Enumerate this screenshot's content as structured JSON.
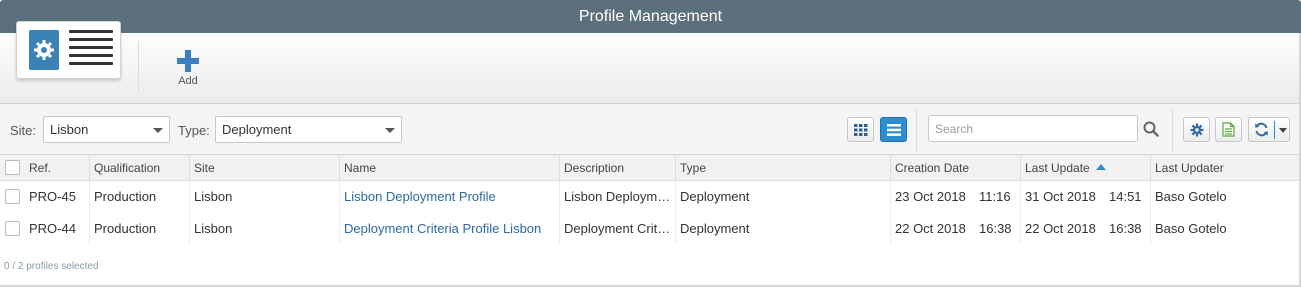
{
  "window": {
    "title": "Profile Management"
  },
  "toolbar": {
    "add_label": "Add"
  },
  "filters": {
    "site_label": "Site:",
    "site_value": "Lisbon",
    "type_label": "Type:",
    "type_value": "Deployment"
  },
  "search": {
    "placeholder": "Search"
  },
  "table": {
    "columns": [
      "Ref.",
      "Qualification",
      "Site",
      "Name",
      "Description",
      "Type",
      "Creation Date",
      "Last Update",
      "Last Updater"
    ],
    "sorted_column": "Last Update",
    "sort_direction": "ascending",
    "rows": [
      {
        "ref": "PRO-45",
        "qualification": "Production",
        "site": "Lisbon",
        "name": "Lisbon Deployment Profile",
        "description": "Lisbon Deploym…",
        "type": "Deployment",
        "creation_date": "23 Oct 2018",
        "creation_time": "11:16",
        "update_date": "31 Oct 2018",
        "update_time": "14:51",
        "updater": "Baso Gotelo"
      },
      {
        "ref": "PRO-44",
        "qualification": "Production",
        "site": "Lisbon",
        "name": "Deployment Criteria Profile Lisbon",
        "description": "Deployment Crit…",
        "type": "Deployment",
        "creation_date": "22 Oct 2018",
        "creation_time": "16:38",
        "update_date": "22 Oct 2018",
        "update_time": "16:38",
        "updater": "Baso Gotelo"
      }
    ]
  },
  "footer": {
    "selection_text": "0 / 2 profiles selected"
  },
  "colors": {
    "titlebar": "#5c6f7c",
    "accent": "#2c8ed0",
    "link": "#2a6aa6"
  },
  "icons": [
    "profile-app-icon",
    "plus-icon",
    "grid-view-icon",
    "list-view-icon",
    "search-icon",
    "gear-icon",
    "export-icon",
    "refresh-icon",
    "caret-down-icon"
  ]
}
